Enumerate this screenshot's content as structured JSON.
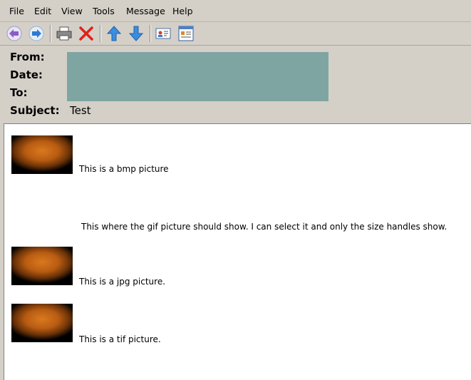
{
  "menu": {
    "items": [
      {
        "id": "file",
        "label": "File"
      },
      {
        "id": "edit",
        "label": "Edit"
      },
      {
        "id": "view",
        "label": "View"
      },
      {
        "id": "tools",
        "label": "Tools"
      },
      {
        "id": "message",
        "label": "Message"
      },
      {
        "id": "help",
        "label": "Help"
      }
    ]
  },
  "toolbar": {
    "buttons": [
      "previous-icon",
      "next-icon",
      "print-icon",
      "delete-icon",
      "previous-message-icon",
      "next-message-icon",
      "addresses-icon",
      "encoding-icon"
    ]
  },
  "header": {
    "from_label": "From:",
    "date_label": "Date:",
    "to_label": "To:",
    "subject_label": "Subject:",
    "subject_value": "Test"
  },
  "body": {
    "bmp_caption": "This is a bmp picture",
    "gif_caption": "This where the gif picture should show. I can select it and only the size handles show.",
    "jpg_caption": "This is a jpg picture.",
    "tif_caption": "This is a tif picture."
  },
  "colors": {
    "chrome": "#d4d0c8",
    "redaction": "#7fa5a3",
    "picture_orange": "#d9791f"
  }
}
